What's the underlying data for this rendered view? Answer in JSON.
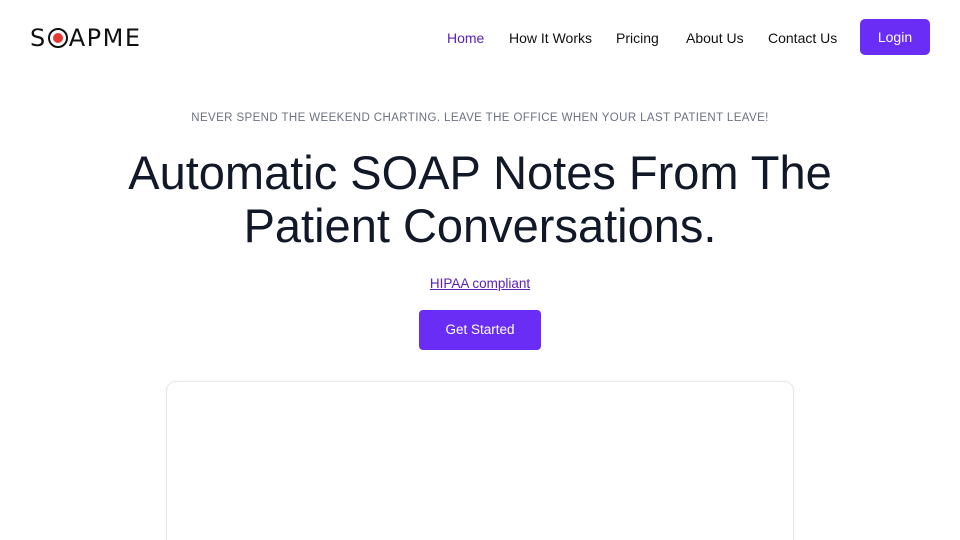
{
  "header": {
    "logo_text_left": "S",
    "logo_text_right": "APME",
    "nav": [
      "Home",
      "How It Works",
      "Pricing",
      "About Us",
      "Contact Us"
    ],
    "active_nav": "Home",
    "login_label": "Login"
  },
  "hero": {
    "tagline": "NEVER SPEND THE WEEKEND CHARTING. LEAVE THE OFFICE WHEN YOUR LAST PATIENT LEAVE!",
    "headline_line1": "Automatic SOAP Notes From The",
    "headline_line2": "Patient Conversations.",
    "hipaa_link": "HIPAA compliant",
    "cta_label": "Get Started"
  },
  "colors": {
    "accent": "#6a2df5",
    "active_link": "#5b21b6",
    "logo_dot": "#e53935"
  }
}
